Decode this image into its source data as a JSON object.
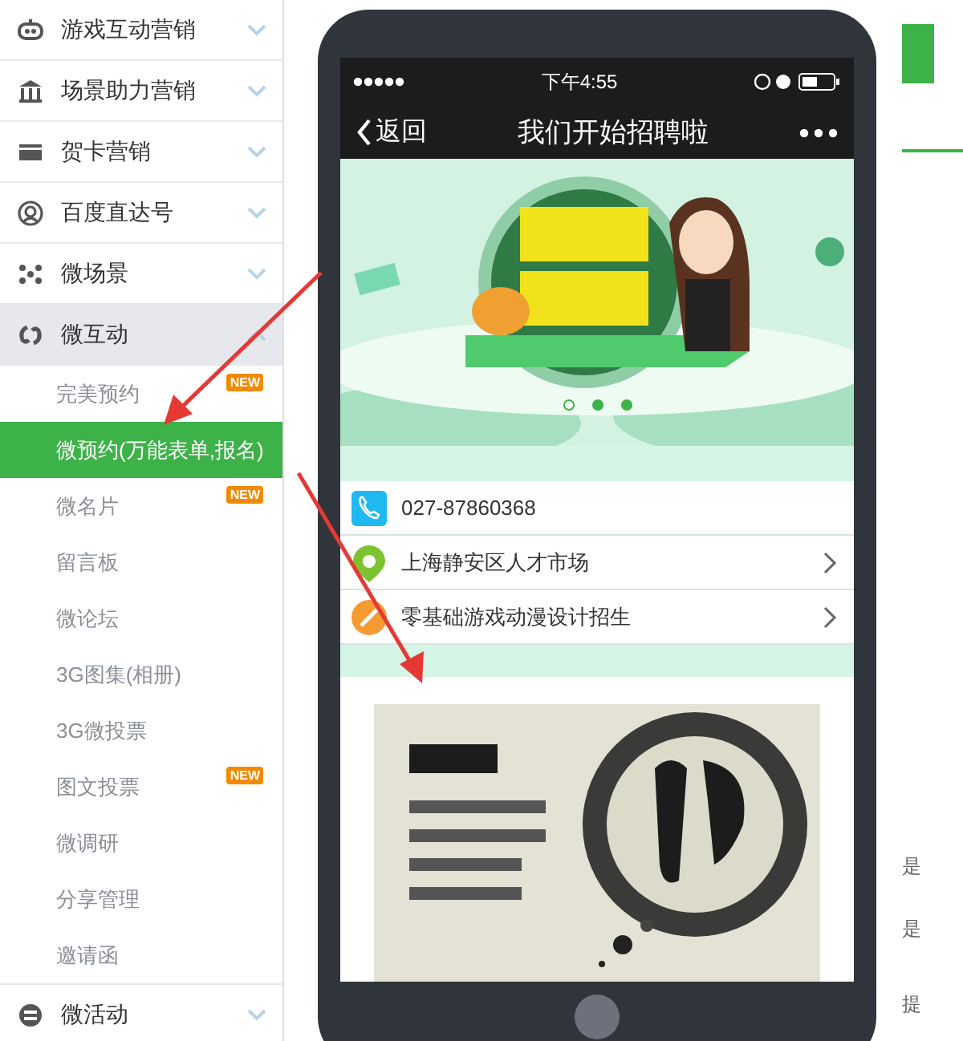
{
  "sidebar": {
    "items": [
      {
        "label": "游戏互动营销",
        "expanded": false
      },
      {
        "label": "场景助力营销",
        "expanded": false
      },
      {
        "label": "贺卡营销",
        "expanded": false
      },
      {
        "label": "百度直达号",
        "expanded": false
      },
      {
        "label": "微场景",
        "expanded": false
      },
      {
        "label": "微互动",
        "expanded": true,
        "children": [
          {
            "label": "完美预约",
            "selected": false,
            "badge": "NEW"
          },
          {
            "label": "微预约(万能表单,报名)",
            "selected": true
          },
          {
            "label": "微名片",
            "selected": false,
            "badge": "NEW"
          },
          {
            "label": "留言板",
            "selected": false
          },
          {
            "label": "微论坛",
            "selected": false
          },
          {
            "label": "3G图集(相册)",
            "selected": false
          },
          {
            "label": "3G微投票",
            "selected": false
          },
          {
            "label": "图文投票",
            "selected": false,
            "badge": "NEW"
          },
          {
            "label": "微调研",
            "selected": false
          },
          {
            "label": "分享管理",
            "selected": false
          },
          {
            "label": "邀请函",
            "selected": false
          }
        ]
      },
      {
        "label": "微活动",
        "expanded": false
      }
    ]
  },
  "phone": {
    "status_bar": {
      "time": "下午4:55"
    },
    "nav_bar": {
      "back": "返回",
      "title": "我们开始招聘啦"
    },
    "banner": {
      "kind": "picture",
      "dots": [
        {
          "selected": true
        },
        {
          "selected": false
        },
        {
          "selected": false
        }
      ]
    },
    "info_rows": [
      {
        "kind": "phone",
        "text": "027-87860368",
        "link": false
      },
      {
        "kind": "location",
        "text": "上海静安区人才市场",
        "link": true
      },
      {
        "kind": "edit",
        "text": "零基础游戏动漫设计招生",
        "link": true
      }
    ]
  },
  "right_panel": {
    "texts": [
      "是",
      "是",
      "提"
    ]
  }
}
